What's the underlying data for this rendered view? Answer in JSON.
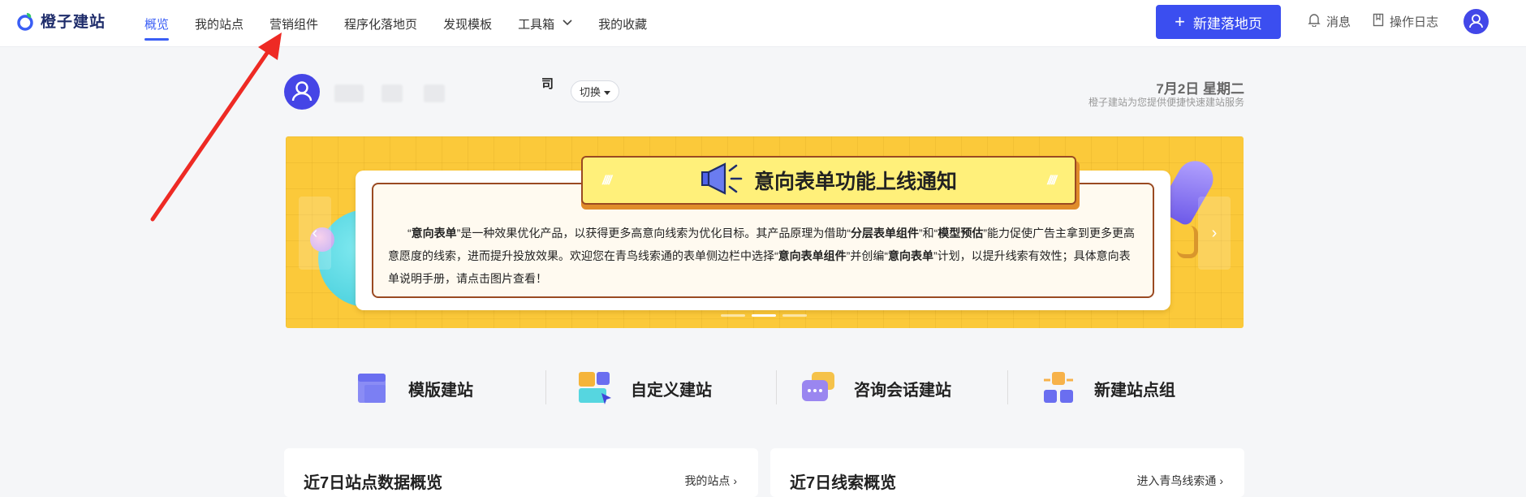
{
  "app": {
    "logo_text": "橙子建站"
  },
  "nav": {
    "items": [
      {
        "label": "概览",
        "active": true
      },
      {
        "label": "我的站点"
      },
      {
        "label": "营销组件"
      },
      {
        "label": "程序化落地页"
      },
      {
        "label": "发现模板"
      },
      {
        "label": "工具箱",
        "has_dropdown": true
      },
      {
        "label": "我的收藏"
      }
    ]
  },
  "header_actions": {
    "new_button": "新建落地页",
    "messages": "消息",
    "oplog": "操作日志"
  },
  "user": {
    "name_tail": "司",
    "switch_label": "切换",
    "date": "7月2日 星期二",
    "date_subtitle": "橙子建站为您提供便捷快速建站服务"
  },
  "banner": {
    "title": "意向表单功能上线通知",
    "text_parts": [
      "“",
      "意向表单",
      "”是一种效果优化产品，以获得更多高意向线索为优化目标。其产品原理为借助“",
      "分层表单组件",
      "”和“",
      "模型预估",
      "”能力促使广告主拿到更多更高意愿度的线索，进而提升投放效果。欢迎您在青鸟线索通的表单侧边栏中选择“",
      "意向表单组件",
      "”并创编“",
      "意向表单",
      "”计划，以提升线索有效性；具体意向表单说明手册，请点击图片查看！"
    ],
    "slides": 3,
    "active_slide": 2
  },
  "quick_actions": [
    {
      "label": "模版建站",
      "icon": "template-icon"
    },
    {
      "label": "自定义建站",
      "icon": "custom-build-icon"
    },
    {
      "label": "咨询会话建站",
      "icon": "chat-build-icon"
    },
    {
      "label": "新建站点组",
      "icon": "site-group-icon"
    }
  ],
  "panels": [
    {
      "title": "近7日站点数据概览",
      "link": "我的站点"
    },
    {
      "title": "近7日线索概览",
      "link": "进入青鸟线索通"
    }
  ],
  "colors": {
    "accent": "#3b4ef0",
    "banner_bg": "#fbc93a",
    "annotation": "#ee2a24"
  }
}
